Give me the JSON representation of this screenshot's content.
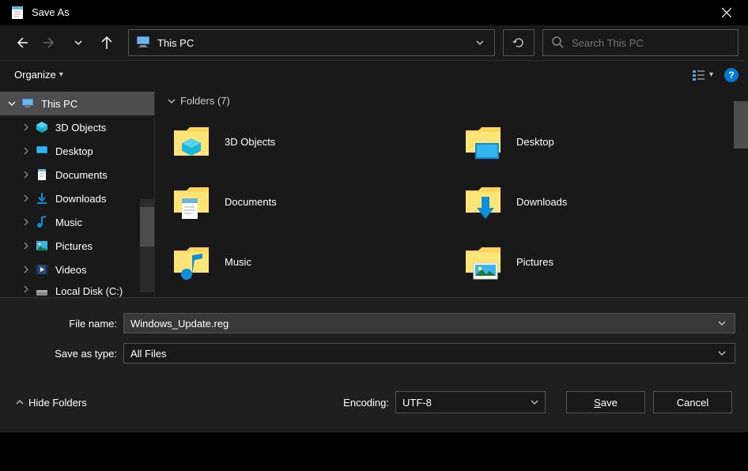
{
  "title": "Save As",
  "nav": {
    "location": "This PC",
    "search_placeholder": "Search This PC"
  },
  "toolbar": {
    "organize": "Organize"
  },
  "tree": {
    "this_pc": "This PC",
    "items": [
      "3D Objects",
      "Desktop",
      "Documents",
      "Downloads",
      "Music",
      "Pictures",
      "Videos",
      "Local Disk (C:)"
    ]
  },
  "content": {
    "section": "Folders (7)",
    "folders": [
      "3D Objects",
      "Desktop",
      "Documents",
      "Downloads",
      "Music",
      "Pictures"
    ]
  },
  "form": {
    "filename_label": "File name:",
    "filename_value": "Windows_Update.reg",
    "type_label": "Save as type:",
    "type_value": "All Files"
  },
  "footer": {
    "hide_folders": "Hide Folders",
    "encoding_label": "Encoding:",
    "encoding_value": "UTF-8",
    "save": "Save",
    "cancel": "Cancel"
  }
}
